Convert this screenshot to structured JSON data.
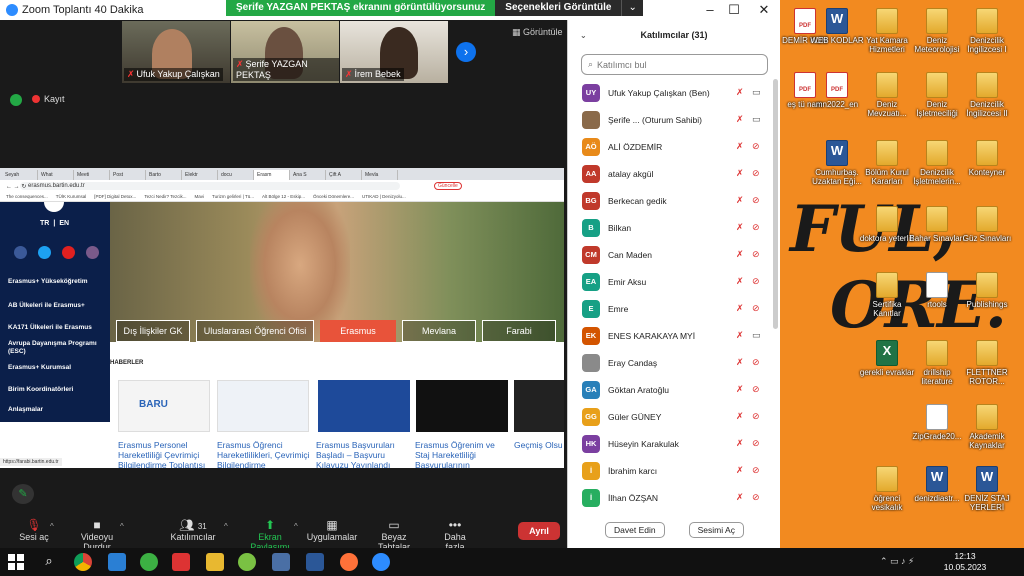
{
  "zoom": {
    "title": "Zoom Toplantı 40 Dakika",
    "share_banner": "Şerife YAZGAN PEKTAŞ ekranını görüntülüyorsunuz",
    "share_options": "Seçenekleri Görüntüle",
    "gallery_view": "Görüntüle",
    "recording": "Kayıt",
    "tiles": [
      {
        "name": "Ufuk Yakup Çalışkan"
      },
      {
        "name": "Şerife YAZGAN PEKTAŞ"
      },
      {
        "name": "İrem Bebek"
      }
    ]
  },
  "browser": {
    "tabs": [
      "Seyah",
      "What",
      "Meeti",
      "Post",
      "Barto",
      "Elektr",
      "docu",
      "Erasm",
      "Ana S",
      "Çift A",
      "Mevla"
    ],
    "url": "erasmus.bartin.edu.tr",
    "update_btn": "Güncelle",
    "bookmarks": [
      "The consequences...",
      "TÜİK Kurumsal",
      "[PDF] Digital Detox...",
      "Tezci Nedir? Tezcik...",
      "Mavi",
      "Turizm gelirleri | Tü...",
      "Alt Bölge 12 - Eskip...",
      "Önceki Dönemlere...",
      "UTIKAD | Denizyolu..."
    ],
    "lang_tr": "TR",
    "lang_en": "EN",
    "left_menu": [
      "Erasmus+ Yükseköğretim",
      "AB Ülkeleri ile Erasmus+",
      "KA171 Ülkeleri ile Erasmus",
      "Avrupa Dayanışma Programı (ESC)",
      "Erasmus+ Kurumsal",
      "Birim Koordinatörleri",
      "Anlaşmalar"
    ],
    "hero_buttons": [
      "Dış İlişkiler GK",
      "Uluslararası Öğrenci Ofisi",
      "Erasmus",
      "Mevlana",
      "Farabi"
    ],
    "news_heading": "HABERLER",
    "news": [
      "Erasmus Personel Hareketliliği Çevrimiçi Bilgilendirme Toplantısı",
      "Erasmus Öğrenci Hareketlilikleri, Çevrimiçi Bilgilendirme",
      "Erasmus Başvuruları Başladı – Başvuru Kılavuzu Yayınlandı",
      "Erasmus Öğrenim ve Staj Hareketliliği Başvurularının",
      "Geçmiş Olsun"
    ],
    "status_url": "https://farabi.bartin.edu.tr"
  },
  "toolbar": {
    "mute": "Sesi aç",
    "video": "Videoyu Durdur",
    "participants": "Katılımcılar",
    "participants_count": "31",
    "share": "Ekran Paylaşımı",
    "apps": "Uygulamalar",
    "whiteboard": "Beyaz Tahtalar",
    "more": "Daha fazla",
    "end": "Ayrıl"
  },
  "panel": {
    "title": "Katılımcılar (31)",
    "search_placeholder": "Katılımcı bul",
    "invite": "Davet Edin",
    "mute_all": "Sesimi Aç",
    "participants": [
      {
        "initials": "UY",
        "name": "Ufuk Yakup Çalışkan (Ben)",
        "color": "#7b3fa0"
      },
      {
        "initials": "",
        "name": "Şerife ...  (Oturum Sahibi)",
        "color": "#8a6a4a"
      },
      {
        "initials": "AÖ",
        "name": "ALİ ÖZDEMİR",
        "color": "#e88a1a"
      },
      {
        "initials": "AA",
        "name": "atalay akgül",
        "color": "#c0392b"
      },
      {
        "initials": "BG",
        "name": "Berkecan gedik",
        "color": "#c0392b"
      },
      {
        "initials": "B",
        "name": "Bilkan",
        "color": "#16a085"
      },
      {
        "initials": "CM",
        "name": "Can Maden",
        "color": "#c0392b"
      },
      {
        "initials": "EA",
        "name": "Emir Aksu",
        "color": "#16a085"
      },
      {
        "initials": "E",
        "name": "Emre",
        "color": "#16a085"
      },
      {
        "initials": "EK",
        "name": "ENES KARAKAYA MYİ",
        "color": "#d35400"
      },
      {
        "initials": "",
        "name": "Eray Candaş",
        "color": "#8a8a8a"
      },
      {
        "initials": "GA",
        "name": "Göktan Aratoğlu",
        "color": "#2980b9"
      },
      {
        "initials": "GG",
        "name": "Güler GÜNEY",
        "color": "#e8a01a"
      },
      {
        "initials": "HK",
        "name": "Hüseyin Karakulak",
        "color": "#7b3fa0"
      },
      {
        "initials": "İ",
        "name": "İbrahim karcı",
        "color": "#e8a01a"
      },
      {
        "initials": "İ",
        "name": "İlhan ÖZŞAN",
        "color": "#27ae60"
      }
    ]
  },
  "desktop": {
    "big_text_1": "FUL,",
    "big_text_2": "ORE.",
    "icons": [
      {
        "label": "DEMİR KUM",
        "type": "pdf"
      },
      {
        "label": "WEB KODLAR",
        "type": "word"
      },
      {
        "label": "Yat Kamara Hizmetleri",
        "type": "folder"
      },
      {
        "label": "Deniz Meteorolojisi",
        "type": "folder"
      },
      {
        "label": "Denizcilik İngilizcesi I",
        "type": "folder"
      },
      {
        "label": "eş tü nam",
        "type": "pdf"
      },
      {
        "label": "mn2022_en",
        "type": "pdf"
      },
      {
        "label": "Deniz Mevzuatı...",
        "type": "folder"
      },
      {
        "label": "Deniz İşletmeciliği",
        "type": "folder"
      },
      {
        "label": "Denizcilik İngilizcesi II",
        "type": "folder"
      },
      {
        "label": "Cumhurbaş. Uzaktan Eği...",
        "type": "word"
      },
      {
        "label": "Bölüm Kurul Kararları",
        "type": "folder"
      },
      {
        "label": "Denizcilik İşletmelerin...",
        "type": "folder"
      },
      {
        "label": "Konteyner",
        "type": "folder"
      },
      {
        "label": "doktora yeterlik",
        "type": "folder"
      },
      {
        "label": "Bahar Sınavları",
        "type": "folder"
      },
      {
        "label": "Güz Sınavları",
        "type": "folder"
      },
      {
        "label": "Sertifika Kanıtlar",
        "type": "folder"
      },
      {
        "label": "rtools",
        "type": "doc"
      },
      {
        "label": "Publishings",
        "type": "folder"
      },
      {
        "label": "gerekli evraklar",
        "type": "excel"
      },
      {
        "label": "drillship literature",
        "type": "folder"
      },
      {
        "label": "FLETTNER ROTOR...",
        "type": "folder"
      },
      {
        "label": "ZipGrade20...",
        "type": "doc"
      },
      {
        "label": "Akademik Kaynaklar",
        "type": "folder"
      },
      {
        "label": "öğrenci vesikalık",
        "type": "folder"
      },
      {
        "label": "denizdiastr...",
        "type": "word"
      },
      {
        "label": "DENİZ STAJ YERLERİ",
        "type": "word"
      }
    ]
  },
  "taskbar": {
    "time": "12:13",
    "date": "10.05.2023"
  }
}
